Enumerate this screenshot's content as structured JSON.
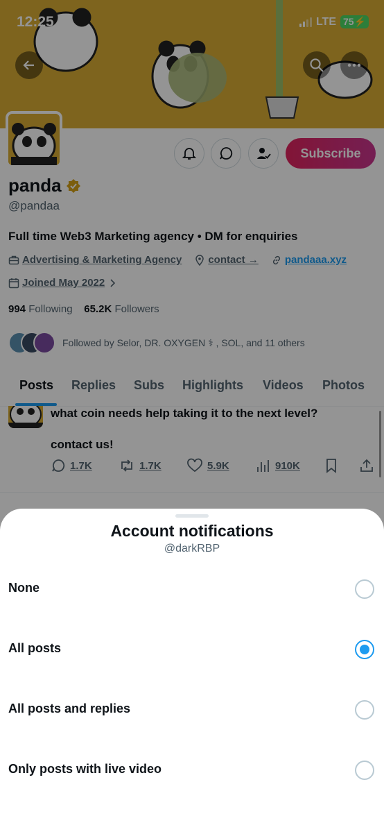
{
  "status": {
    "time": "12:25",
    "network": "LTE",
    "battery": "75"
  },
  "profile": {
    "name": "panda",
    "handle": "@pandaa",
    "bio": "Full time Web3 Marketing agency • DM for enquiries",
    "category": "Advertising & Marketing Agency",
    "location": "contact →",
    "website": "pandaaa.xyz",
    "joined": "Joined May 2022",
    "following_count": "994",
    "following_label": "Following",
    "followers_count": "65.2K",
    "followers_label": "Followers",
    "followed_by": "Followed by Selor, DR. OXYGEN ⚕ , SOL, and 11 others",
    "subscribe_label": "Subscribe"
  },
  "tabs": [
    {
      "label": "Posts"
    },
    {
      "label": "Replies"
    },
    {
      "label": "Subs"
    },
    {
      "label": "Highlights"
    },
    {
      "label": "Videos"
    },
    {
      "label": "Photos"
    }
  ],
  "tweet": {
    "line1": "what coin needs help taking it to the next level?",
    "line2": "contact us!",
    "replies": "1.7K",
    "reposts": "1.7K",
    "likes": "5.9K",
    "views": "910K"
  },
  "sheet": {
    "title": "Account notifications",
    "subtitle": "@darkRBP",
    "options": [
      {
        "label": "None",
        "selected": false
      },
      {
        "label": "All posts",
        "selected": true
      },
      {
        "label": "All posts and replies",
        "selected": false
      },
      {
        "label": "Only posts with live video",
        "selected": false
      }
    ]
  },
  "colors": {
    "accent": "#1d9bf0",
    "subscribe": "#e0245e",
    "banner": "#d9ad35"
  }
}
